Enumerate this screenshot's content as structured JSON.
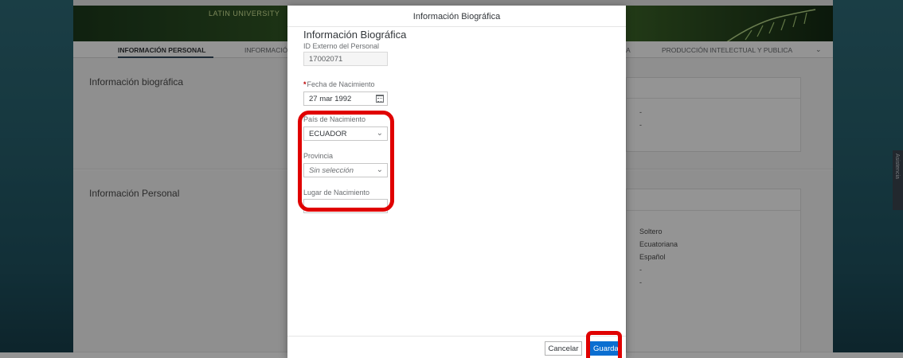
{
  "background": {
    "banner_text": "LATIN UNIVERSITY",
    "nav_tabs": [
      {
        "label": "INFORMACIÓN PERSONAL",
        "active": true
      },
      {
        "label": "INFORMACIÓ",
        "active": false
      },
      {
        "label": "A",
        "active": false
      },
      {
        "label": "PRODUCCIÓN INTELECTUAL Y PUBLICA",
        "active": false
      }
    ],
    "section_bio_title": "Información biográfica",
    "section_bio_values": [
      "-",
      "-"
    ],
    "section_personal_title": "Información Personal",
    "section_personal_values": [
      "Soltero",
      "Ecuatoriana",
      "Español",
      "-",
      "-"
    ],
    "side_tab_label": "Asistencia"
  },
  "dialog": {
    "title": "Información Biográfica",
    "form_title": "Información Biográfica",
    "external_id": {
      "label": "ID Externo del Personal",
      "value": "17002071"
    },
    "birth_date": {
      "required_mark": "*",
      "label": "Fecha de Nacimiento",
      "value": "27 mar 1992"
    },
    "birth_country": {
      "label": "País de Nacimiento",
      "value": "ECUADOR"
    },
    "province": {
      "label": "Provincia",
      "placeholder": "Sin selección"
    },
    "birth_place": {
      "label": "Lugar de Nacimiento",
      "value": ""
    },
    "cancel_label": "Cancelar",
    "save_label": "Guardar"
  },
  "colors": {
    "primary_button": "#0a6ed1",
    "highlight": "#e00000",
    "required": "#bb0000"
  }
}
